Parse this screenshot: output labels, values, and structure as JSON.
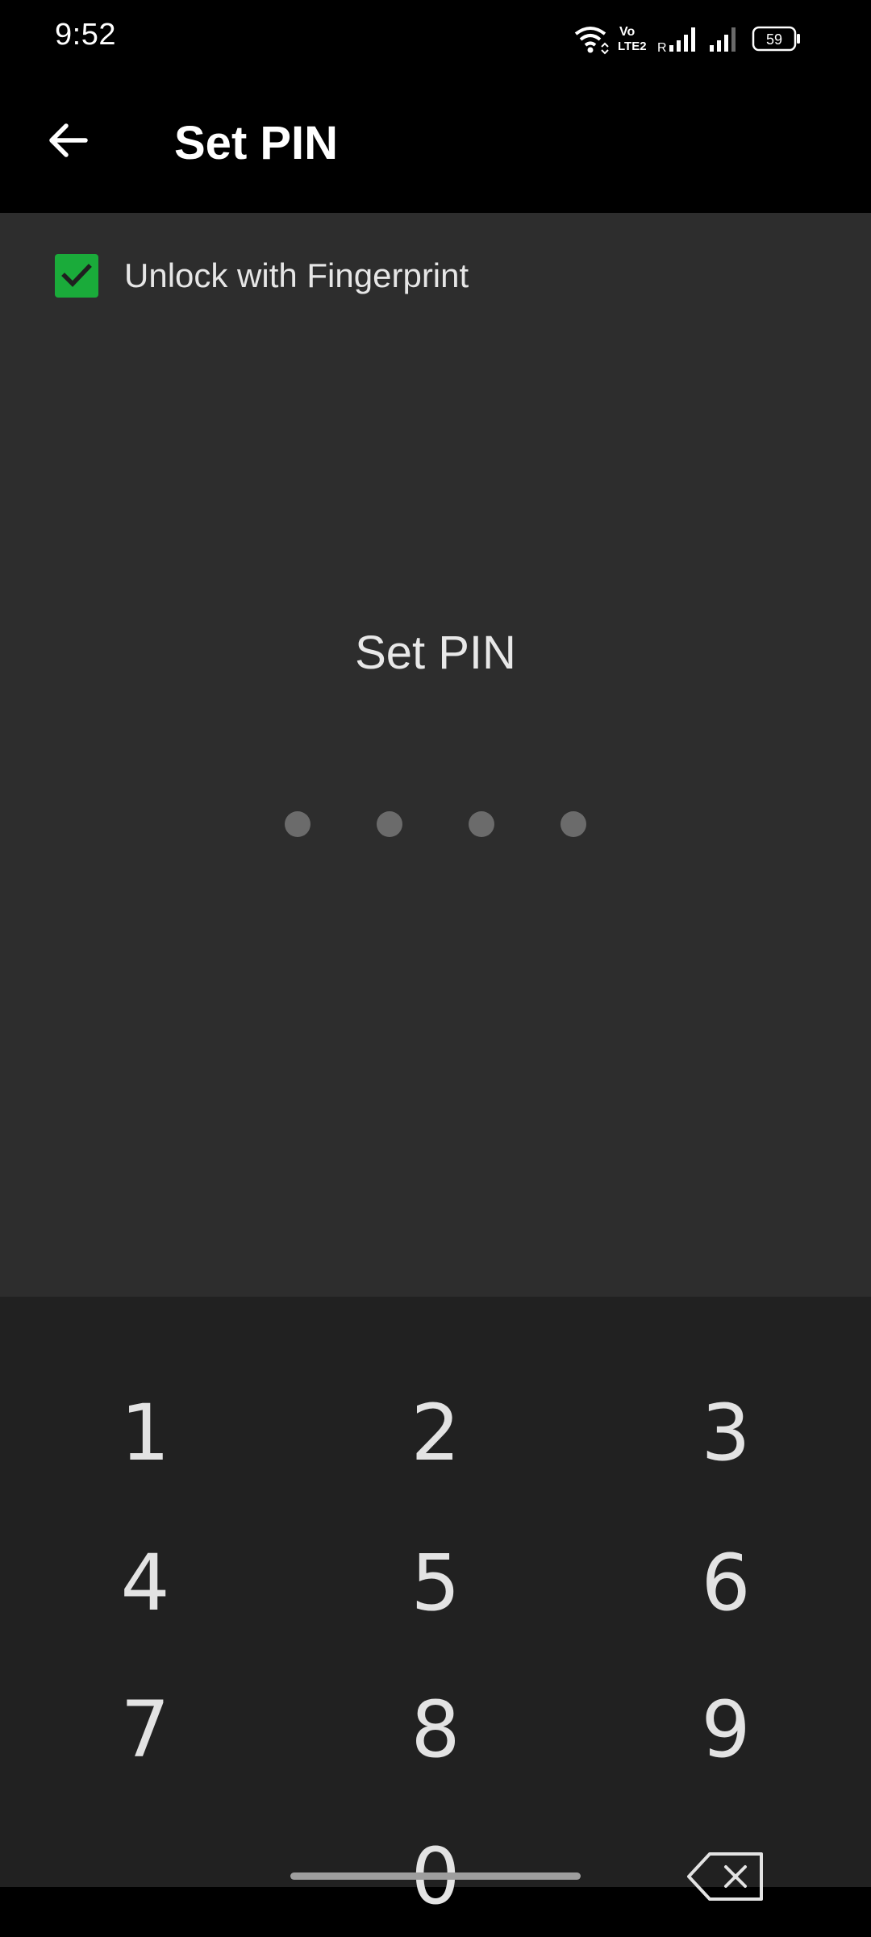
{
  "status_bar": {
    "time": "9:52",
    "volte_label_top": "Vo",
    "volte_label_bottom": "LTE2",
    "roaming_label": "R",
    "battery": "59",
    "icons": [
      "wifi-icon",
      "volte-icon",
      "signal-icon",
      "signal-icon",
      "battery-icon"
    ]
  },
  "app_bar": {
    "title": "Set PIN",
    "back_icon": "arrow-back-icon"
  },
  "fingerprint": {
    "label": "Unlock with Fingerprint",
    "checked": true,
    "checkbox_color": "#1aab3a"
  },
  "pin_entry": {
    "title": "Set PIN",
    "digits_entered": 0,
    "length": 4
  },
  "keypad": {
    "keys": [
      "1",
      "2",
      "3",
      "4",
      "5",
      "6",
      "7",
      "8",
      "9",
      "0"
    ],
    "backspace_icon": "backspace-icon"
  },
  "colors": {
    "background": "#000000",
    "content_background": "#2d2d2d",
    "keypad_background": "#212121",
    "accent": "#1aab3a"
  }
}
